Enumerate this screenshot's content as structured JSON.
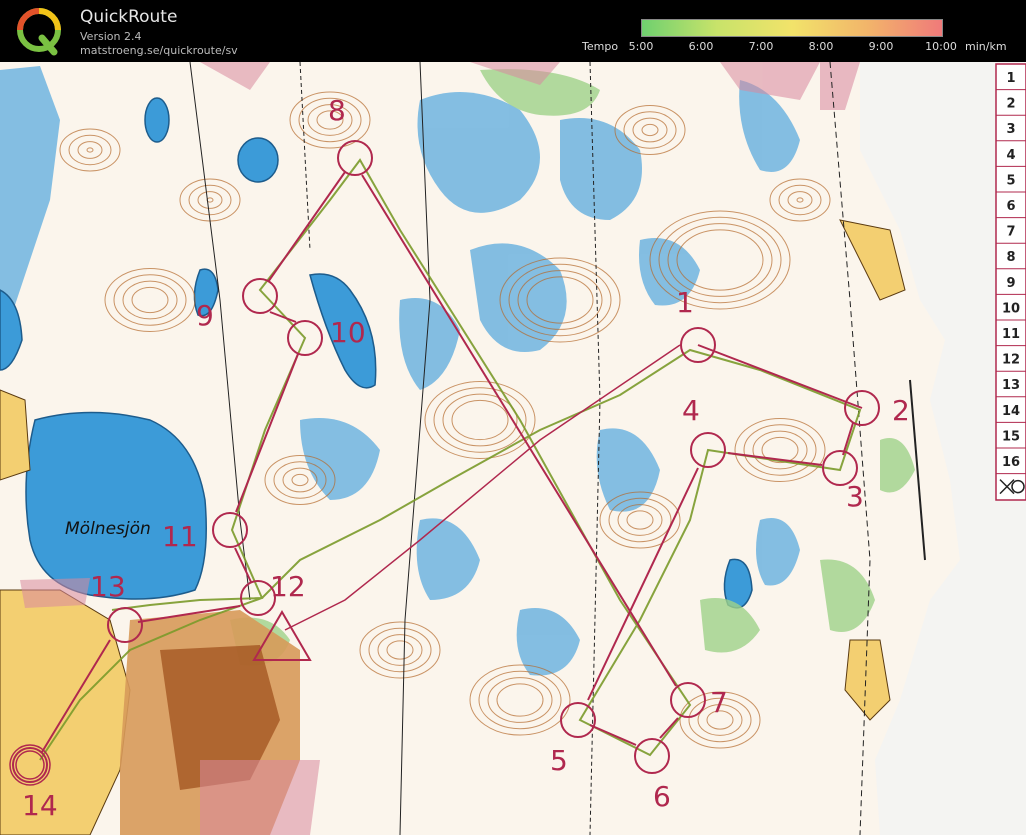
{
  "app": {
    "title": "QuickRoute",
    "version": "Version 2.4",
    "url": "matstroeng.se/quickroute/sv",
    "logo_letter": "Q"
  },
  "tempo": {
    "label": "Tempo",
    "unit": "min/km",
    "ticks": [
      "5:00",
      "6:00",
      "7:00",
      "8:00",
      "9:00",
      "10:00"
    ],
    "gradient_colors": [
      "#6fd06f",
      "#c8e36a",
      "#f2e36a",
      "#f2b56a",
      "#f07a7a"
    ]
  },
  "map": {
    "lake_name": "Mölnesjön",
    "controls": [
      "1",
      "2",
      "3",
      "4",
      "5",
      "6",
      "7",
      "8",
      "9",
      "10",
      "11",
      "12",
      "13",
      "14"
    ],
    "description_numbers": [
      "1",
      "2",
      "3",
      "4",
      "5",
      "6",
      "7",
      "8",
      "9",
      "10",
      "11",
      "12",
      "13",
      "14",
      "15",
      "16"
    ],
    "colors": {
      "paper": "#fbf5ec",
      "marsh": "#55a8dc",
      "open_land": "#f3cf71",
      "vegetation": "#9fd28a",
      "contour": "#b56a2c",
      "course": "#b0284e",
      "route": "#7a9a2a",
      "urban": "#d79a5a"
    }
  }
}
